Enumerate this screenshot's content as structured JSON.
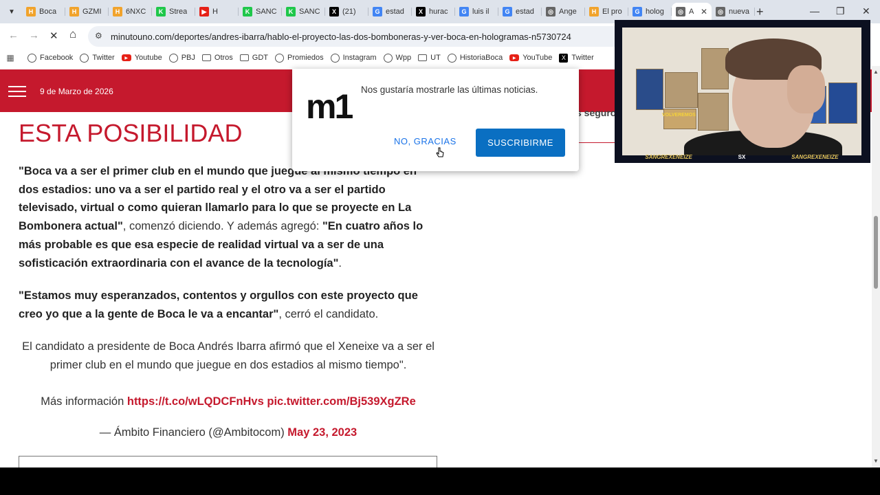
{
  "browser": {
    "tabs": [
      {
        "label": "Boca",
        "favicon": "H",
        "fav_color": "#f1a32c"
      },
      {
        "label": "GZMI",
        "favicon": "H",
        "fav_color": "#f1a32c"
      },
      {
        "label": "6NXC",
        "favicon": "H",
        "fav_color": "#f1a32c"
      },
      {
        "label": "Strea",
        "favicon": "K",
        "fav_color": "#1fc74a"
      },
      {
        "label": "H",
        "favicon": "▶",
        "fav_color": "#e62117"
      },
      {
        "label": "SANC",
        "favicon": "K",
        "fav_color": "#1fc74a"
      },
      {
        "label": "SANC",
        "favicon": "K",
        "fav_color": "#1fc74a"
      },
      {
        "label": "(21)",
        "favicon": "X",
        "fav_color": "#000000"
      },
      {
        "label": "estad",
        "favicon": "G",
        "fav_color": "#4285f4"
      },
      {
        "label": "hurac",
        "favicon": "X",
        "fav_color": "#000000"
      },
      {
        "label": "luis il",
        "favicon": "G",
        "fav_color": "#4285f4"
      },
      {
        "label": "estad",
        "favicon": "G",
        "fav_color": "#4285f4"
      },
      {
        "label": "Ange",
        "favicon": "◎",
        "fav_color": "#666666"
      },
      {
        "label": "El pro",
        "favicon": "H",
        "fav_color": "#f1a32c"
      },
      {
        "label": "holog",
        "favicon": "G",
        "fav_color": "#4285f4"
      },
      {
        "label": "A",
        "favicon": "◎",
        "fav_color": "#666666",
        "active": true
      },
      {
        "label": "nueva",
        "favicon": "◎",
        "fav_color": "#666666"
      }
    ],
    "new_tab": "+",
    "minimize": "—",
    "restore": "❐",
    "close": "✕",
    "back": "←",
    "forward": "→",
    "reload": "✕",
    "home": "⌂",
    "url": "minutouno.com/deportes/andres-ibarra/hablo-el-proyecto-las-dos-bomboneras-y-ver-boca-en-hologramas-n5730724",
    "bookmarks": [
      {
        "label": "Facebook",
        "icon": "globe"
      },
      {
        "label": "Twitter",
        "icon": "globe"
      },
      {
        "label": "Youtube",
        "icon": "yt"
      },
      {
        "label": "PBJ",
        "icon": "globe"
      },
      {
        "label": "Otros",
        "icon": "folder"
      },
      {
        "label": "GDT",
        "icon": "folder"
      },
      {
        "label": "Promiedos",
        "icon": "globe"
      },
      {
        "label": "Instagram",
        "icon": "globe"
      },
      {
        "label": "Wpp",
        "icon": "globe"
      },
      {
        "label": "UT",
        "icon": "folder"
      },
      {
        "label": "HistoriaBoca",
        "icon": "globe"
      },
      {
        "label": "YouTube",
        "icon": "yt"
      },
      {
        "label": "Twitter",
        "icon": "x"
      }
    ]
  },
  "site": {
    "date": "9 de Marzo de 2026",
    "side_snippet": "s seguro",
    "brand_color": "#c5192d"
  },
  "article": {
    "headline": "ESTA POSIBILIDAD",
    "p1_bold": "\"Boca va a ser el primer club en el mundo que juegue al mismo tiempo en dos estadios: uno va a ser el partido real y el otro va a ser el partido televisado, virtual o como quieran llamarlo para lo que se proyecte en La Bombonera actual\"",
    "p1_mid": ", comenzó diciendo. Y además agregó: ",
    "p1_bold2": "\"En cuatro años lo más probable es que esa especie de realidad virtual va a ser de una sofisticación extraordinaria con el avance de la tecnología\"",
    "p1_end": ".",
    "p2_bold": "\"Estamos muy esperanzados, contentos y orgullos con este proyecto que creo yo que a la gente de Boca le va a encantar\"",
    "p2_end": ", cerró el candidato.",
    "tweet_text": "El candidato a presidente de Boca Andrés Ibarra afirmó que el Xeneixe va a ser el primer club en el mundo que juegue en dos estadios al mismo tiempo\".",
    "tweet_more": "Más información ",
    "tweet_link1": "https://t.co/wLQDCFnHvs",
    "tweet_link2": "pic.twitter.com/Bj539XgZRe",
    "tweet_author": "— Ámbito Financiero (@Ambitocom) ",
    "tweet_date": "May 23, 2023"
  },
  "popup": {
    "logo": "m1",
    "message": "Nos gustaría mostrarle las últimas noticias.",
    "no_button": "NO, GRACIAS",
    "yes_button": "SUSCRIBIRME"
  },
  "webcam": {
    "handle_left": "SANGREXENEIZE",
    "logo": "SX",
    "handle_right": "SANGREXENEIZE",
    "poster_text": "VOLVEREMOS"
  }
}
